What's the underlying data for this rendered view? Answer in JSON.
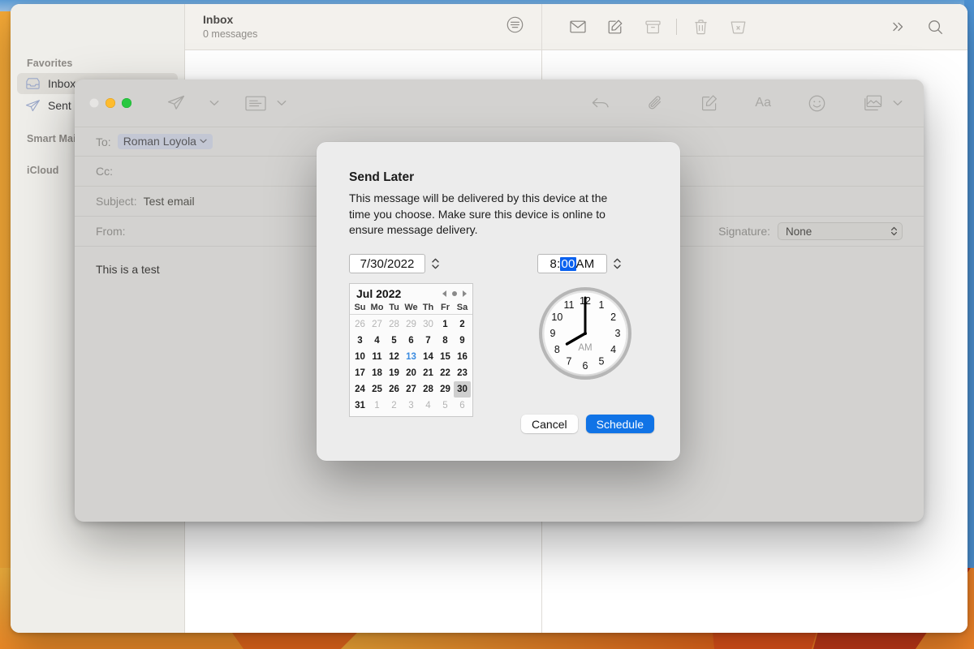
{
  "desktop": {
    "wallpaper_name": "monterey-orange-shards"
  },
  "mail_window": {
    "sidebar": {
      "sections": [
        {
          "header": "Favorites",
          "items": [
            {
              "label": "Inbox",
              "icon": "inbox-icon",
              "selected": true
            },
            {
              "label": "Sent",
              "icon": "paper-plane-icon",
              "selected": false
            }
          ]
        },
        {
          "header": "Smart Mail",
          "items": []
        },
        {
          "header": "iCloud",
          "items": []
        }
      ]
    },
    "list_header": {
      "title": "Inbox",
      "subtitle": "0 messages",
      "filter_icon": "sort-filter-icon"
    },
    "toolbar": {
      "buttons": [
        {
          "name": "get-mail-button",
          "icon": "envelope-icon",
          "enabled": true
        },
        {
          "name": "compose-button",
          "icon": "compose-icon",
          "enabled": true
        },
        {
          "name": "archive-button",
          "icon": "archive-icon",
          "enabled": false
        },
        {
          "name": "delete-button",
          "icon": "trash-icon",
          "enabled": false
        },
        {
          "name": "junk-button",
          "icon": "junk-bin-icon",
          "enabled": false
        },
        {
          "name": "more-button",
          "icon": "chevrons-right-icon",
          "enabled": true
        },
        {
          "name": "search-button",
          "icon": "search-icon",
          "enabled": true
        }
      ]
    }
  },
  "compose_window": {
    "titlebar": {
      "traffic_lights": [
        "close",
        "minimize",
        "zoom"
      ],
      "left_buttons": [
        {
          "name": "send-button",
          "icon": "send-arrow-icon"
        },
        {
          "name": "send-options-chevron",
          "icon": "chevron-down-icon"
        },
        {
          "name": "stationery-button",
          "icon": "stationery-icon"
        },
        {
          "name": "stationery-chevron",
          "icon": "chevron-down-icon"
        }
      ],
      "right_buttons": [
        {
          "name": "undo-button",
          "icon": "undo-arrow-icon"
        },
        {
          "name": "attach-button",
          "icon": "paperclip-icon"
        },
        {
          "name": "markup-button",
          "icon": "markup-icon"
        },
        {
          "name": "format-button",
          "icon": "aa-format-icon",
          "text": "Aa"
        },
        {
          "name": "emoji-button",
          "icon": "emoji-smiley-icon"
        },
        {
          "name": "photos-button",
          "icon": "photo-browser-icon"
        },
        {
          "name": "photos-chevron",
          "icon": "chevron-down-icon"
        }
      ]
    },
    "fields": {
      "to_label": "To:",
      "to_value": "Roman Loyola",
      "cc_label": "Cc:",
      "cc_value": "",
      "subject_label": "Subject:",
      "subject_value": "Test email",
      "from_label": "From:",
      "from_value": "",
      "signature_label": "Signature:",
      "signature_value": "None"
    },
    "body_text": "This is a test"
  },
  "dialog": {
    "title": "Send Later",
    "description": "This message will be delivered by this device at the time you choose. Make sure this device is online to ensure message delivery.",
    "date_field": {
      "value": "7/30/2022",
      "stepper_icon": "stepper-up-down-icon"
    },
    "time_field": {
      "hour": "8",
      "colon": ":",
      "minutes": "00",
      "period": " AM",
      "minutes_selected": true,
      "stepper_icon": "stepper-up-down-icon"
    },
    "calendar": {
      "month_label": "Jul 2022",
      "prev_icon": "triangle-left-icon",
      "today_dot_icon": "dot-icon",
      "next_icon": "triangle-right-icon",
      "day_headers": [
        "Su",
        "Mo",
        "Tu",
        "We",
        "Th",
        "Fr",
        "Sa"
      ],
      "weeks": [
        [
          {
            "d": "26",
            "out": true
          },
          {
            "d": "27",
            "out": true
          },
          {
            "d": "28",
            "out": true
          },
          {
            "d": "29",
            "out": true
          },
          {
            "d": "30",
            "out": true
          },
          {
            "d": "1"
          },
          {
            "d": "2"
          }
        ],
        [
          {
            "d": "3"
          },
          {
            "d": "4"
          },
          {
            "d": "5"
          },
          {
            "d": "6"
          },
          {
            "d": "7"
          },
          {
            "d": "8"
          },
          {
            "d": "9"
          }
        ],
        [
          {
            "d": "10"
          },
          {
            "d": "11"
          },
          {
            "d": "12"
          },
          {
            "d": "13",
            "today": true
          },
          {
            "d": "14"
          },
          {
            "d": "15"
          },
          {
            "d": "16"
          }
        ],
        [
          {
            "d": "17"
          },
          {
            "d": "18"
          },
          {
            "d": "19"
          },
          {
            "d": "20"
          },
          {
            "d": "21"
          },
          {
            "d": "22"
          },
          {
            "d": "23"
          }
        ],
        [
          {
            "d": "24"
          },
          {
            "d": "25"
          },
          {
            "d": "26"
          },
          {
            "d": "27"
          },
          {
            "d": "28"
          },
          {
            "d": "29"
          },
          {
            "d": "30",
            "selected": true
          }
        ],
        [
          {
            "d": "31"
          },
          {
            "d": "1",
            "out": true
          },
          {
            "d": "2",
            "out": true
          },
          {
            "d": "3",
            "out": true
          },
          {
            "d": "4",
            "out": true
          },
          {
            "d": "5",
            "out": true
          },
          {
            "d": "6",
            "out": true
          }
        ]
      ]
    },
    "clock": {
      "period_label": "AM",
      "hour_value": 8,
      "minute_value": 0,
      "numerals": [
        "12",
        "1",
        "2",
        "3",
        "4",
        "5",
        "6",
        "7",
        "8",
        "9",
        "10",
        "11"
      ]
    },
    "buttons": {
      "cancel": "Cancel",
      "schedule": "Schedule"
    },
    "accent_color": "#1073e6",
    "selection_color": "#0a61ef",
    "today_color": "#3a8be0"
  }
}
